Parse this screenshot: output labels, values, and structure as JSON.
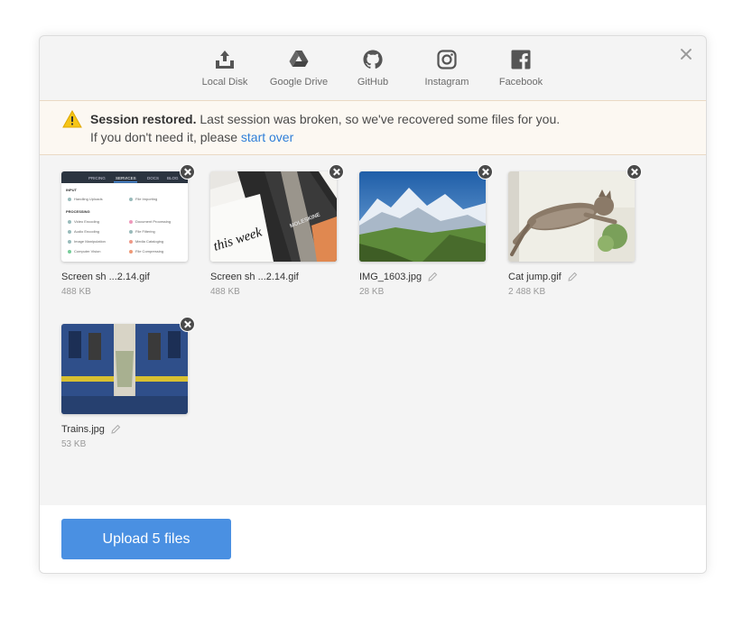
{
  "providers": [
    {
      "label": "Local Disk",
      "icon": "local-disk-icon"
    },
    {
      "label": "Google Drive",
      "icon": "google-drive-icon"
    },
    {
      "label": "GitHub",
      "icon": "github-icon"
    },
    {
      "label": "Instagram",
      "icon": "instagram-icon"
    },
    {
      "label": "Facebook",
      "icon": "facebook-icon"
    }
  ],
  "notice": {
    "title": "Session restored.",
    "message": "Last session was broken, so we've recovered some files for you.",
    "line2_prefix": "If you don't need it, please",
    "link": "start over"
  },
  "files": [
    {
      "name": "Screen sh ...2.14.gif",
      "size": "488 KB",
      "editable": false
    },
    {
      "name": "Screen sh ...2.14.gif",
      "size": "488 KB",
      "editable": false
    },
    {
      "name": "IMG_1603.jpg",
      "size": "28 KB",
      "editable": true
    },
    {
      "name": "Cat jump.gif",
      "size": "2 488 KB",
      "editable": true
    },
    {
      "name": "Trains.jpg",
      "size": "53 KB",
      "editable": true
    }
  ],
  "screenshot_thumb": {
    "nav": [
      "PRICING",
      "SERVICES",
      "DOCS",
      "BLOG"
    ],
    "section1": "INPUT",
    "row1": [
      "Handling Uploads",
      "File Importing"
    ],
    "section2": "PROCESSING",
    "rows": [
      [
        "Video Encoding",
        "Document Processing"
      ],
      [
        "Audio Encoding",
        "File Filtering"
      ],
      [
        "Image Manipulation",
        "Media Cataloging"
      ],
      [
        "Computer Vision",
        "File Compressing"
      ]
    ]
  },
  "notebook_thumb": {
    "handwriting": "this week",
    "brand": "MOLESKINE"
  },
  "footer": {
    "upload_label": "Upload 5 files"
  },
  "colors": {
    "accent": "#4a90e2",
    "link": "#2f7fd8",
    "notice_bg": "#fcf8f2",
    "warning": "#f5c518"
  }
}
